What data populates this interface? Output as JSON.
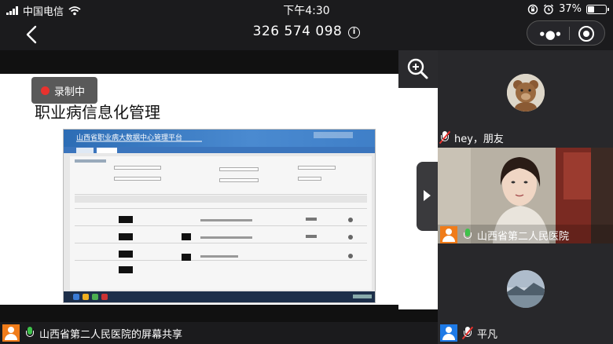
{
  "status_bar": {
    "carrier": "中国电信",
    "time": "下午4:30",
    "battery_percent": "37%",
    "battery_level": 0.37
  },
  "nav": {
    "meeting_id": "326 574 098",
    "info_symbol": "i"
  },
  "share": {
    "recording_label": "录制中",
    "slide_title": "职业病信息化管理",
    "platform_title": "山西省职业病大数据中心管理平台",
    "sharer_label": "山西省第二人民医院的屏幕共享"
  },
  "participants": [
    {
      "name": "hey，朋友",
      "mic": "muted",
      "avatar": "teddy-bear"
    },
    {
      "name": "山西省第二人民医院",
      "mic": "active",
      "avatar": "video"
    },
    {
      "name": "平凡",
      "mic": "muted",
      "avatar": "landscape"
    }
  ],
  "colors": {
    "background": "#1b1b1d",
    "panel": "#28282b",
    "record_red": "#e8322e",
    "mic_green": "#3ec24a",
    "orange_avatar": "#f07c1a",
    "blue_avatar": "#1e7ae6"
  }
}
